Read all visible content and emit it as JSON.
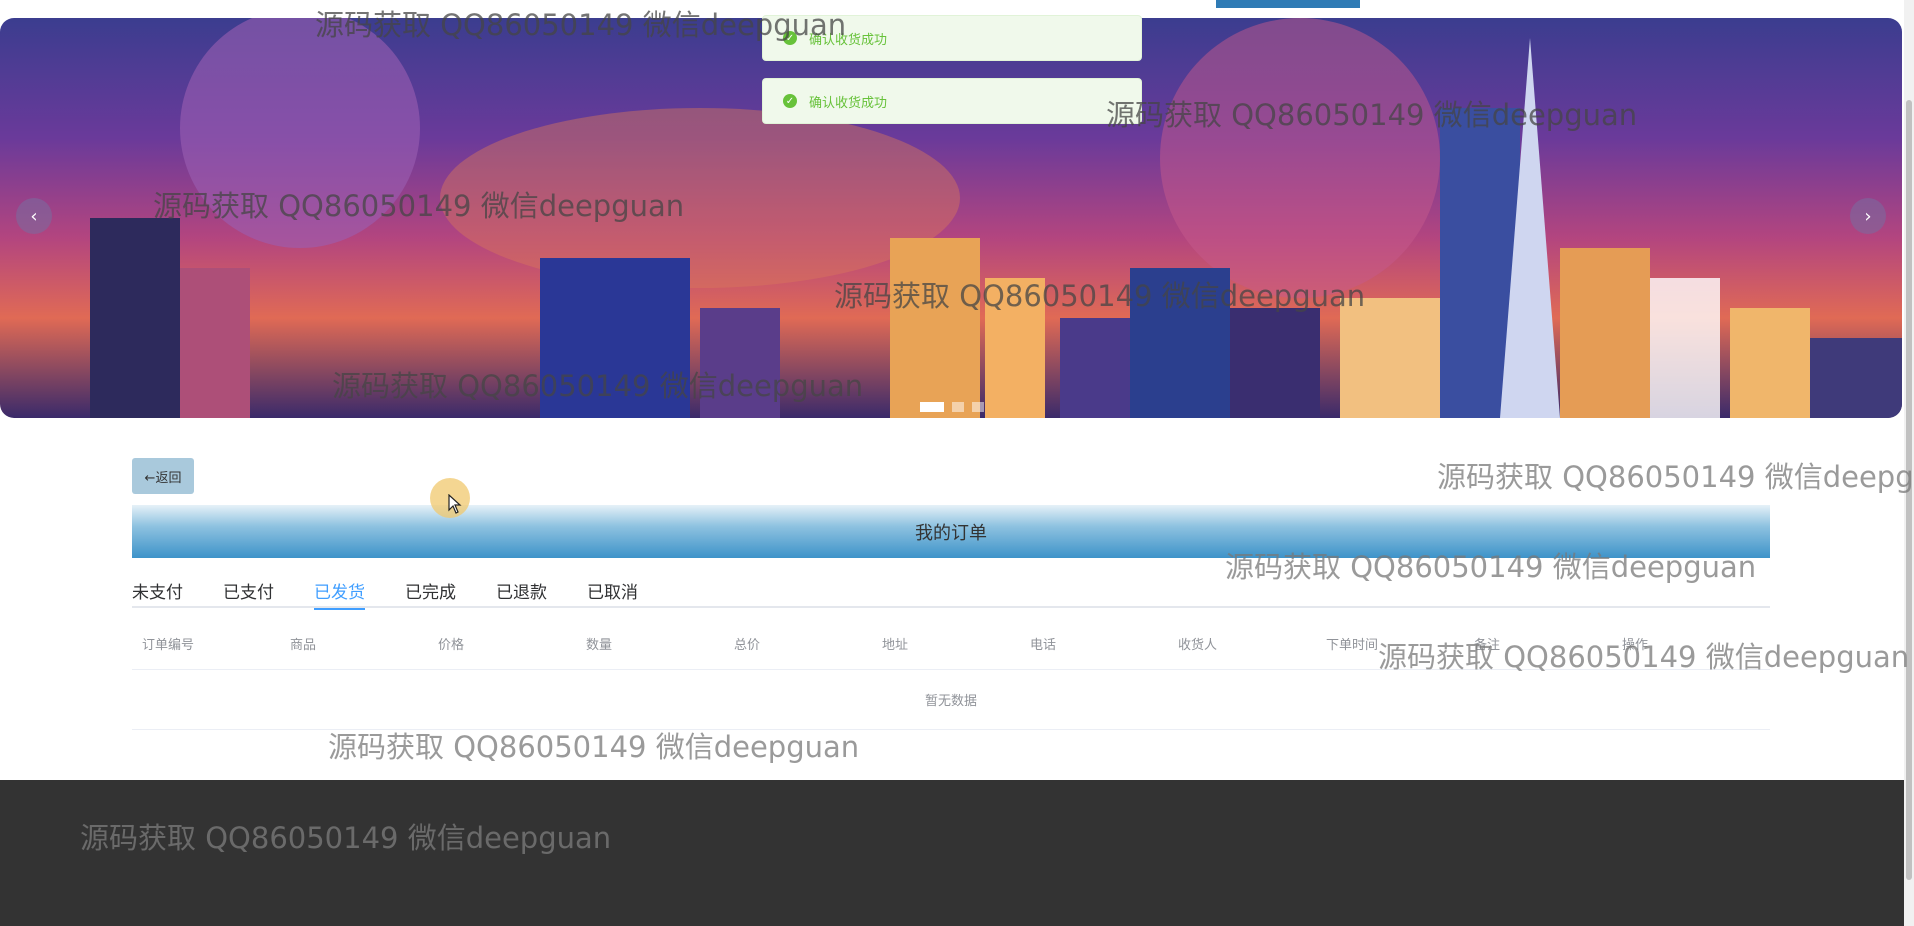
{
  "toasts": [
    "确认收货成功",
    "确认收货成功"
  ],
  "banner": {
    "prev_glyph": "‹",
    "next_glyph": "›",
    "slide_count": 3,
    "active_slide": 1
  },
  "back_button": {
    "label": "←返回"
  },
  "page_title": "我的订单",
  "tabs": [
    {
      "label": "未支付"
    },
    {
      "label": "已支付"
    },
    {
      "label": "已发货"
    },
    {
      "label": "已完成"
    },
    {
      "label": "已退款"
    },
    {
      "label": "已取消"
    }
  ],
  "active_tab": 2,
  "table": {
    "columns": [
      "订单编号",
      "商品",
      "价格",
      "数量",
      "总价",
      "地址",
      "电话",
      "收货人",
      "下单时间",
      "备注",
      "操作"
    ],
    "empty_text": "暂无数据"
  },
  "watermark": "源码获取 QQ86050149 微信deepguan",
  "colors": {
    "accent": "#409eff",
    "success": "#67c23a",
    "footer": "#333333",
    "title_bar": "#3d93c9"
  },
  "icons": [
    "check-circle-icon",
    "chevron-left-icon",
    "chevron-right-icon",
    "arrow-left-icon",
    "cursor-icon"
  ]
}
